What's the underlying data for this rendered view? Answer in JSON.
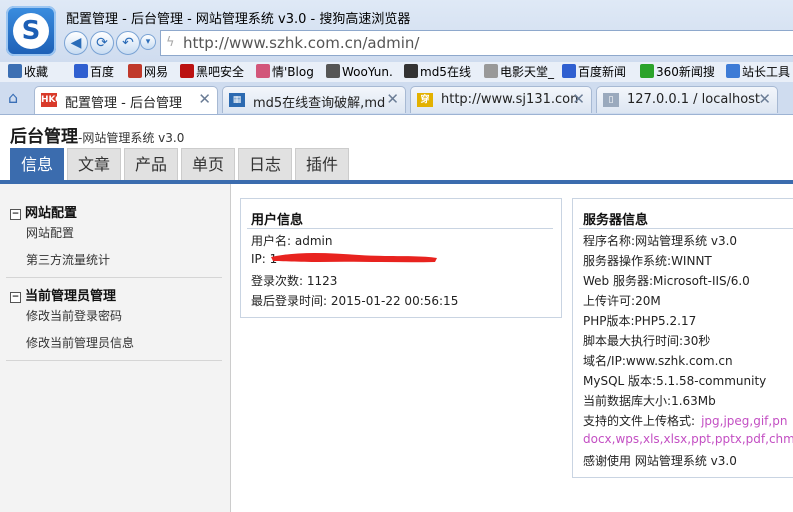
{
  "browser": {
    "window_title": "配置管理 - 后台管理 - 网站管理系统 v3.0 - 搜狗高速浏览器",
    "address": "http://www.szhk.com.cn/admin/",
    "bookmarks": [
      {
        "label": "收藏",
        "color": "#3c6fb3"
      },
      {
        "label": "百度",
        "color": "#2f5fd0"
      },
      {
        "label": "网易",
        "color": "#c0392b"
      },
      {
        "label": "黑吧安全",
        "color": "#b11"
      },
      {
        "label": "情'Blog",
        "color": "#d2557a"
      },
      {
        "label": "WooYun.",
        "color": "#555"
      },
      {
        "label": "md5在线",
        "color": "#333"
      },
      {
        "label": "电影天堂_",
        "color": "#999"
      },
      {
        "label": "百度新闻",
        "color": "#2f5fd0"
      },
      {
        "label": "360新闻搜",
        "color": "#2ba32b"
      },
      {
        "label": "站长工具",
        "color": "#3d7bd6"
      }
    ],
    "tabs": [
      {
        "label": "配置管理 - 后台管理",
        "icon_text": "HKC",
        "icon_color": "#d93a2a",
        "active": true
      },
      {
        "label": "md5在线查询破解,md",
        "icon_text": "▦",
        "icon_color": "#2c6ab1",
        "active": false
      },
      {
        "label": "http://www.sj131.con",
        "icon_text": "穿",
        "icon_color": "#e3b100",
        "active": false
      },
      {
        "label": "127.0.0.1 / localhost",
        "icon_text": "▯",
        "icon_color": "#9aa9bd",
        "active": false
      }
    ]
  },
  "page": {
    "title": "后台管理",
    "subtitle": "-网站管理系统 v3.0",
    "nav_tabs": [
      "信息",
      "文章",
      "产品",
      "单页",
      "日志",
      "插件"
    ],
    "active_nav": 0
  },
  "sidebar": {
    "sections": [
      {
        "title": "网站配置",
        "items": [
          "网站配置",
          "第三方流量统计"
        ]
      },
      {
        "title": "当前管理员管理",
        "items": [
          "修改当前登录密码",
          "修改当前管理员信息"
        ]
      }
    ]
  },
  "user_info": {
    "title": "用户信息",
    "rows": [
      {
        "label": "用户名",
        "value": "admin"
      },
      {
        "label": "IP",
        "value": "1"
      },
      {
        "label": "登录次数",
        "value": "1123"
      },
      {
        "label": "最后登录时间",
        "value": "2015-01-22 00:56:15"
      }
    ]
  },
  "server_info": {
    "title": "服务器信息",
    "rows": [
      {
        "label": "程序名称",
        "value": "网站管理系统 v3.0"
      },
      {
        "label": "服务器操作系统",
        "value": "WINNT"
      },
      {
        "label": "Web 服务器",
        "value": "Microsoft-IIS/6.0"
      },
      {
        "label": "上传许可",
        "value": "20M"
      },
      {
        "label": "PHP版本",
        "value": "PHP5.2.17"
      },
      {
        "label": "脚本最大执行时间",
        "value": "30秒"
      },
      {
        "label": "域名/IP",
        "value": "www.szhk.com.cn"
      },
      {
        "label": "MySQL 版本",
        "value": "5.1.58-community"
      },
      {
        "label": "当前数据库大小",
        "value": "1.63Mb"
      },
      {
        "label": "支持的文件上传格式",
        "value": "jpg,jpeg,gif,pn"
      },
      {
        "label": "",
        "value": "docx,wps,xls,xlsx,ppt,pptx,pdf,chm"
      },
      {
        "label": "感谢使用",
        "value": "网站管理系统 v3.0"
      }
    ]
  },
  "colors": {
    "accent": "#3b6cae",
    "link_pink": "#c34fc3",
    "redaction": "#e8231f"
  }
}
